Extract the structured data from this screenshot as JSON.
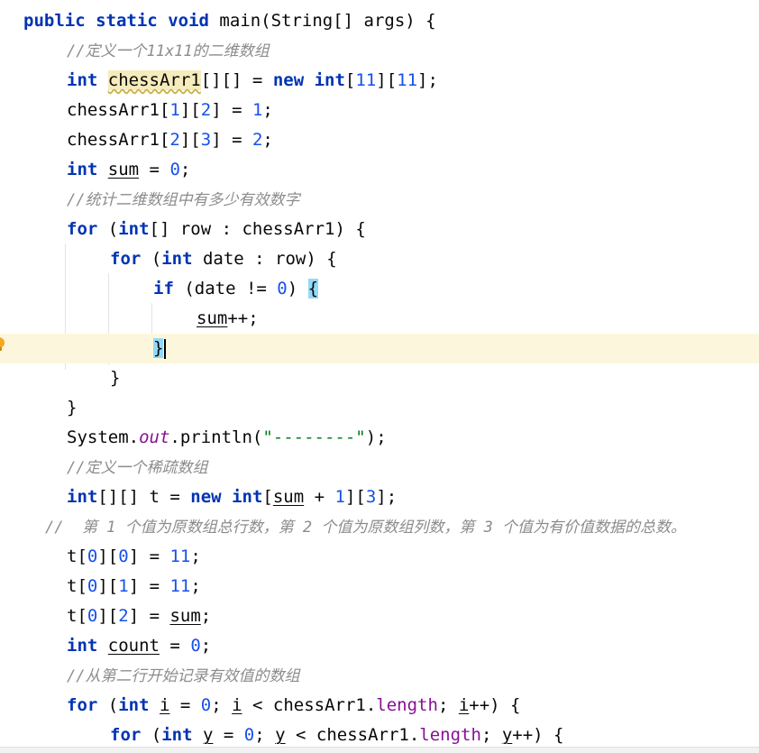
{
  "editor": {
    "lines": [
      {
        "segments": [
          {
            "t": "public",
            "c": "kw"
          },
          {
            "t": " "
          },
          {
            "t": "static",
            "c": "kw"
          },
          {
            "t": " "
          },
          {
            "t": "void",
            "c": "kw"
          },
          {
            "t": " main(String[] args) {"
          }
        ]
      },
      {
        "segments": [
          {
            "t": "//定义一个11x11的二维数组",
            "c": "cmt"
          }
        ]
      },
      {
        "segments": [
          {
            "t": "int",
            "c": "kw"
          },
          {
            "t": " "
          },
          {
            "t": "chessArr1",
            "c": "warn"
          },
          {
            "t": "[][] = "
          },
          {
            "t": "new",
            "c": "kw"
          },
          {
            "t": " "
          },
          {
            "t": "int",
            "c": "kw"
          },
          {
            "t": "["
          },
          {
            "t": "11",
            "c": "num"
          },
          {
            "t": "]["
          },
          {
            "t": "11",
            "c": "num"
          },
          {
            "t": "];"
          }
        ]
      },
      {
        "segments": [
          {
            "t": "chessArr1["
          },
          {
            "t": "1",
            "c": "num"
          },
          {
            "t": "]["
          },
          {
            "t": "2",
            "c": "num"
          },
          {
            "t": "] = "
          },
          {
            "t": "1",
            "c": "num"
          },
          {
            "t": ";"
          }
        ]
      },
      {
        "segments": [
          {
            "t": "chessArr1["
          },
          {
            "t": "2",
            "c": "num"
          },
          {
            "t": "]["
          },
          {
            "t": "3",
            "c": "num"
          },
          {
            "t": "] = "
          },
          {
            "t": "2",
            "c": "num"
          },
          {
            "t": ";"
          }
        ]
      },
      {
        "segments": [
          {
            "t": "int",
            "c": "kw"
          },
          {
            "t": " "
          },
          {
            "t": "sum",
            "c": "ul"
          },
          {
            "t": " = "
          },
          {
            "t": "0",
            "c": "num"
          },
          {
            "t": ";"
          }
        ]
      },
      {
        "segments": [
          {
            "t": "//统计二维数组中有多少有效数字",
            "c": "cmt"
          }
        ]
      },
      {
        "segments": [
          {
            "t": "for",
            "c": "kw"
          },
          {
            "t": " ("
          },
          {
            "t": "int",
            "c": "kw"
          },
          {
            "t": "[] row : chessArr1) {"
          }
        ]
      },
      {
        "segments": [
          {
            "t": "for",
            "c": "kw"
          },
          {
            "t": " ("
          },
          {
            "t": "int",
            "c": "kw"
          },
          {
            "t": " date : row) {"
          }
        ]
      },
      {
        "segments": [
          {
            "t": "if",
            "c": "kw"
          },
          {
            "t": " (date != "
          },
          {
            "t": "0",
            "c": "num"
          },
          {
            "t": ") "
          },
          {
            "t": "{",
            "c": "brace-match"
          }
        ]
      },
      {
        "segments": [
          {
            "t": "sum",
            "c": "ul"
          },
          {
            "t": "++;"
          }
        ]
      },
      {
        "segments": [
          {
            "t": "}",
            "c": "brace-match"
          }
        ]
      },
      {
        "segments": [
          {
            "t": "}"
          }
        ]
      },
      {
        "segments": [
          {
            "t": "}"
          }
        ]
      },
      {
        "segments": [
          {
            "t": "System."
          },
          {
            "t": "out",
            "c": "fld"
          },
          {
            "t": ".println("
          },
          {
            "t": "\"--------\"",
            "c": "str"
          },
          {
            "t": ");"
          }
        ]
      },
      {
        "segments": [
          {
            "t": "//定义一个稀疏数组",
            "c": "cmt"
          }
        ]
      },
      {
        "segments": [
          {
            "t": "int",
            "c": "kw"
          },
          {
            "t": "[][] t = "
          },
          {
            "t": "new",
            "c": "kw"
          },
          {
            "t": " "
          },
          {
            "t": "int",
            "c": "kw"
          },
          {
            "t": "["
          },
          {
            "t": "sum",
            "c": "ul"
          },
          {
            "t": " + "
          },
          {
            "t": "1",
            "c": "num"
          },
          {
            "t": "]["
          },
          {
            "t": "3",
            "c": "num"
          },
          {
            "t": "];"
          }
        ]
      },
      {
        "segments": [
          {
            "t": "//  第 1 个值为原数组总行数，第 2 个值为原数组列数，第 3 个值为有价值数据的总数。",
            "c": "cmt"
          }
        ]
      },
      {
        "segments": [
          {
            "t": "t["
          },
          {
            "t": "0",
            "c": "num"
          },
          {
            "t": "]["
          },
          {
            "t": "0",
            "c": "num"
          },
          {
            "t": "] = "
          },
          {
            "t": "11",
            "c": "num"
          },
          {
            "t": ";"
          }
        ]
      },
      {
        "segments": [
          {
            "t": "t["
          },
          {
            "t": "0",
            "c": "num"
          },
          {
            "t": "]["
          },
          {
            "t": "1",
            "c": "num"
          },
          {
            "t": "] = "
          },
          {
            "t": "11",
            "c": "num"
          },
          {
            "t": ";"
          }
        ]
      },
      {
        "segments": [
          {
            "t": "t["
          },
          {
            "t": "0",
            "c": "num"
          },
          {
            "t": "]["
          },
          {
            "t": "2",
            "c": "num"
          },
          {
            "t": "] = "
          },
          {
            "t": "sum",
            "c": "ul"
          },
          {
            "t": ";"
          }
        ]
      },
      {
        "segments": [
          {
            "t": "int",
            "c": "kw"
          },
          {
            "t": " "
          },
          {
            "t": "count",
            "c": "ul"
          },
          {
            "t": " = "
          },
          {
            "t": "0",
            "c": "num"
          },
          {
            "t": ";"
          }
        ]
      },
      {
        "segments": [
          {
            "t": "//从第二行开始记录有效值的数组",
            "c": "cmt"
          }
        ]
      },
      {
        "segments": [
          {
            "t": "for",
            "c": "kw"
          },
          {
            "t": " ("
          },
          {
            "t": "int",
            "c": "kw"
          },
          {
            "t": " "
          },
          {
            "t": "i",
            "c": "ul"
          },
          {
            "t": " = "
          },
          {
            "t": "0",
            "c": "num"
          },
          {
            "t": "; "
          },
          {
            "t": "i",
            "c": "ul"
          },
          {
            "t": " < chessArr1."
          },
          {
            "t": "length",
            "c": "prop"
          },
          {
            "t": "; "
          },
          {
            "t": "i",
            "c": "ul"
          },
          {
            "t": "++) {"
          }
        ]
      },
      {
        "segments": [
          {
            "t": "for",
            "c": "kw"
          },
          {
            "t": " ("
          },
          {
            "t": "int",
            "c": "kw"
          },
          {
            "t": " "
          },
          {
            "t": "y",
            "c": "ul"
          },
          {
            "t": " = "
          },
          {
            "t": "0",
            "c": "num"
          },
          {
            "t": "; "
          },
          {
            "t": "y",
            "c": "ul"
          },
          {
            "t": " < chessArr1."
          },
          {
            "t": "length",
            "c": "prop"
          },
          {
            "t": "; "
          },
          {
            "t": "y",
            "c": "ul"
          },
          {
            "t": "++) {"
          }
        ]
      }
    ],
    "current_line_index": 11,
    "icons": {
      "gutter_hint": "lightbulb-icon"
    },
    "colors": {
      "keyword": "#0033b3",
      "number": "#1750eb",
      "string": "#067d17",
      "static_field": "#871094",
      "comment": "#8c8c8c",
      "current_line": "#fcf7dc",
      "brace_match": "#93d9f9",
      "bulb": "#f5a623"
    }
  }
}
